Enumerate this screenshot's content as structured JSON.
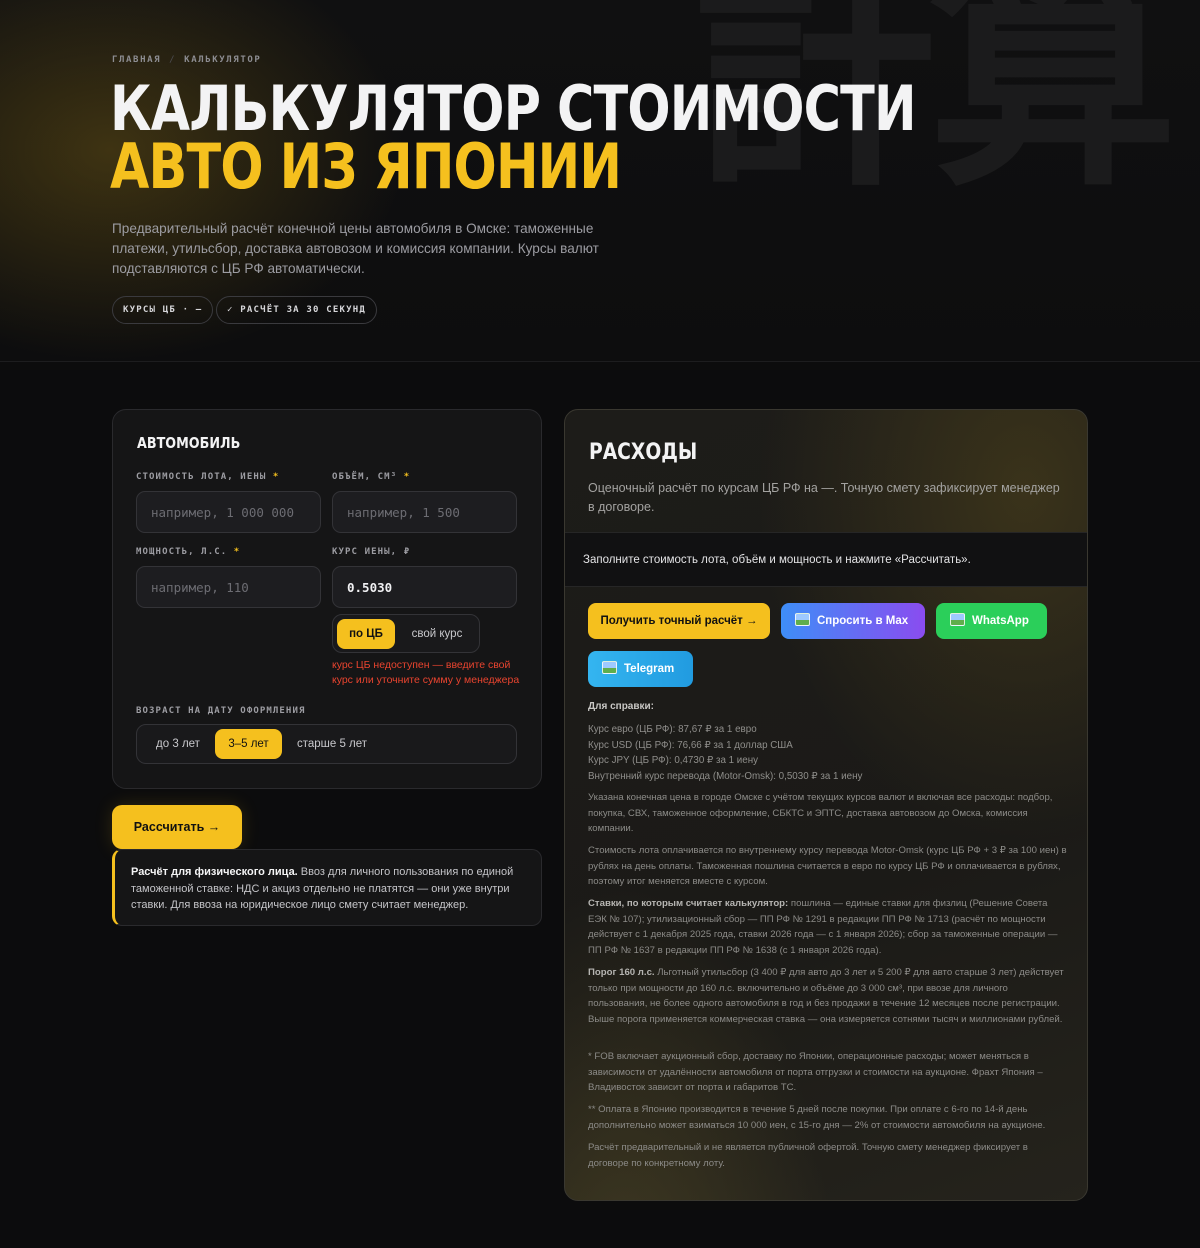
{
  "hero": {
    "watermark": "計算",
    "breadcrumb": {
      "home": "ГЛАВНАЯ",
      "sep": "/",
      "current": "КАЛЬКУЛЯТОР"
    },
    "title_line1": "КАЛЬКУЛЯТОР СТОИМОСТИ",
    "title_line2": "АВТО ИЗ ЯПОНИИ",
    "lead": "Предварительный расчёт конечной цены автомобиля в Омске: таможенные платежи, утильсбор, доставка автовозом и комиссия компании. Курсы валют подставляются с ЦБ РФ автоматически.",
    "chips": [
      "КУРСЫ ЦБ · —",
      "✓ РАСЧЁТ ЗА 30 СЕКУНД"
    ]
  },
  "car_form": {
    "title": "АВТОМОБИЛЬ",
    "lot_price": {
      "label": "СТОИМОСТЬ ЛОТА, ИЕНЫ",
      "req": "*",
      "placeholder": "например, 1 000 000",
      "value": ""
    },
    "volume": {
      "label": "ОБЪЁМ, СМ³",
      "req": "*",
      "placeholder": "например, 1 500",
      "value": ""
    },
    "power": {
      "label": "МОЩНОСТЬ, Л.С.",
      "req": "*",
      "placeholder": "например, 110",
      "value": ""
    },
    "yen_rate": {
      "label": "КУРС ИЕНЫ, ₽",
      "placeholder": "",
      "value": "0.5030"
    },
    "rate_mode": {
      "options": [
        "по ЦБ",
        "свой курс"
      ],
      "selected": "по ЦБ"
    },
    "rate_error": "курс ЦБ недоступен — введите свой курс или уточните сумму у менеджера",
    "age": {
      "label": "ВОЗРАСТ НА ДАТУ ОФОРМЛЕНИЯ",
      "options": [
        "до 3 лет",
        "3–5 лет",
        "старше 5 лет"
      ],
      "selected": "3–5 лет"
    }
  },
  "calc_button": "Рассчитать →",
  "note": {
    "bold": "Расчёт для физического лица.",
    "text": " Ввоз для личного пользования по единой таможенной ставке: НДС и акциз отдельно не платятся — они уже внутри ставки. Для ввоза на юридическое лицо смету считает менеджер."
  },
  "expenses": {
    "title": "РАСХОДЫ",
    "subtitle": "Оценочный расчёт по курсам ЦБ РФ на —. Точную смету зафиксирует менеджер в договоре.",
    "placeholder_msg": "Заполните стоимость лота, объём и мощность и нажмите «Рассчитать».",
    "actions": {
      "exact": "Получить точный расчёт →",
      "max": "Спросить в Max",
      "whatsapp": "WhatsApp",
      "telegram": "Telegram"
    },
    "ref_head": "Для справки:",
    "rates": [
      "Курс евро (ЦБ РФ): 87,67 ₽ за 1 евро",
      "Курс USD (ЦБ РФ): 76,66 ₽ за 1 доллар США",
      "Курс JPY (ЦБ РФ): 0,4730 ₽ за 1 иену",
      "Внутренний курс перевода (Motor-Omsk): 0,5030 ₽ за 1 иену"
    ],
    "p1": "Указана конечная цена в городе Омске с учётом текущих курсов валют и включая все расходы: подбор, покупка, СВХ, таможенное оформление, СБКТС и ЭПТС, доставка автовозом до Омска, комиссия компании.",
    "p2": "Стоимость лота оплачивается по внутреннему курсу перевода Motor-Omsk (курс ЦБ РФ + 3 ₽ за 100 иен) в рублях на день оплаты. Таможенная пошлина считается в евро по курсу ЦБ РФ и оплачивается в рублях, поэтому итог меняется вместе с курсом.",
    "p3_bold": "Ставки, по которым считает калькулятор:",
    "p3": " пошлина — единые ставки для физлиц (Решение Совета ЕЭК № 107); утилизационный сбор — ПП РФ № 1291 в редакции ПП РФ № 1713 (расчёт по мощности действует с 1 декабря 2025 года, ставки 2026 года — с 1 января 2026); сбор за таможенные операции — ПП РФ № 1637 в редакции ПП РФ № 1638 (с 1 января 2026 года).",
    "p4_bold": "Порог 160 л.с.",
    "p4": " Льготный утильсбор (3 400 ₽ для авто до 3 лет и 5 200 ₽ для авто старше 3 лет) действует только при мощности до 160 л.с. включительно и объёме до 3 000 см³, при ввозе для личного пользования, не более одного автомобиля в год и без продажи в течение 12 месяцев после регистрации. Выше порога применяется коммерческая ставка — она измеряется сотнями тысяч и миллионами рублей.",
    "p5": "* FOB включает аукционный сбор, доставку по Японии, операционные расходы; может меняться в зависимости от удалённости автомобиля от порта отгрузки и стоимости на аукционе. Фрахт Япония – Владивосток зависит от порта и габаритов ТС.",
    "p6": "** Оплата в Японию производится в течение 5 дней после покупки. При оплате с 6-го по 14-й день дополнительно может взиматься 10 000 иен, с 15-го дня — 2% от стоимости автомобиля на аукционе.",
    "p7": "Расчёт предварительный и не является публичной офертой. Точную смету менеджер фиксирует в договоре по конкретному лоту."
  },
  "colors": {
    "accent": "#f5c01e",
    "error": "#e9442f",
    "whatsapp": "#2bcf5a",
    "telegram": "#34b5f0"
  }
}
